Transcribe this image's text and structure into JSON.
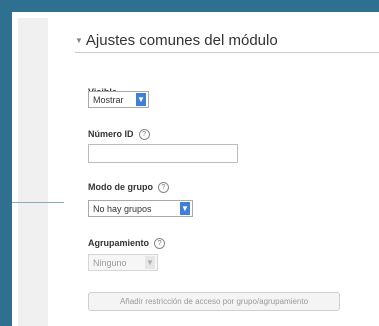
{
  "section": {
    "toggle_icon": "triangle-down-icon",
    "title": "Ajustes comunes del módulo"
  },
  "fields": {
    "visible": {
      "label": "Visible",
      "value": "Mostrar"
    },
    "id_number": {
      "label": "Número ID",
      "value": "",
      "help_icon": "help-icon"
    },
    "group_mode": {
      "label": "Modo de grupo",
      "value": "No hay grupos",
      "help_icon": "help-icon"
    },
    "grouping": {
      "label": "Agrupamiento",
      "value": "Ninguno",
      "help_icon": "help-icon",
      "disabled": true
    }
  },
  "restriction_button": {
    "label": "Añadir restricción de acceso por grupo/agrupamiento",
    "disabled": true
  },
  "colors": {
    "frame": "#2f6f8f",
    "select_arrow": "#3f7fd9"
  }
}
